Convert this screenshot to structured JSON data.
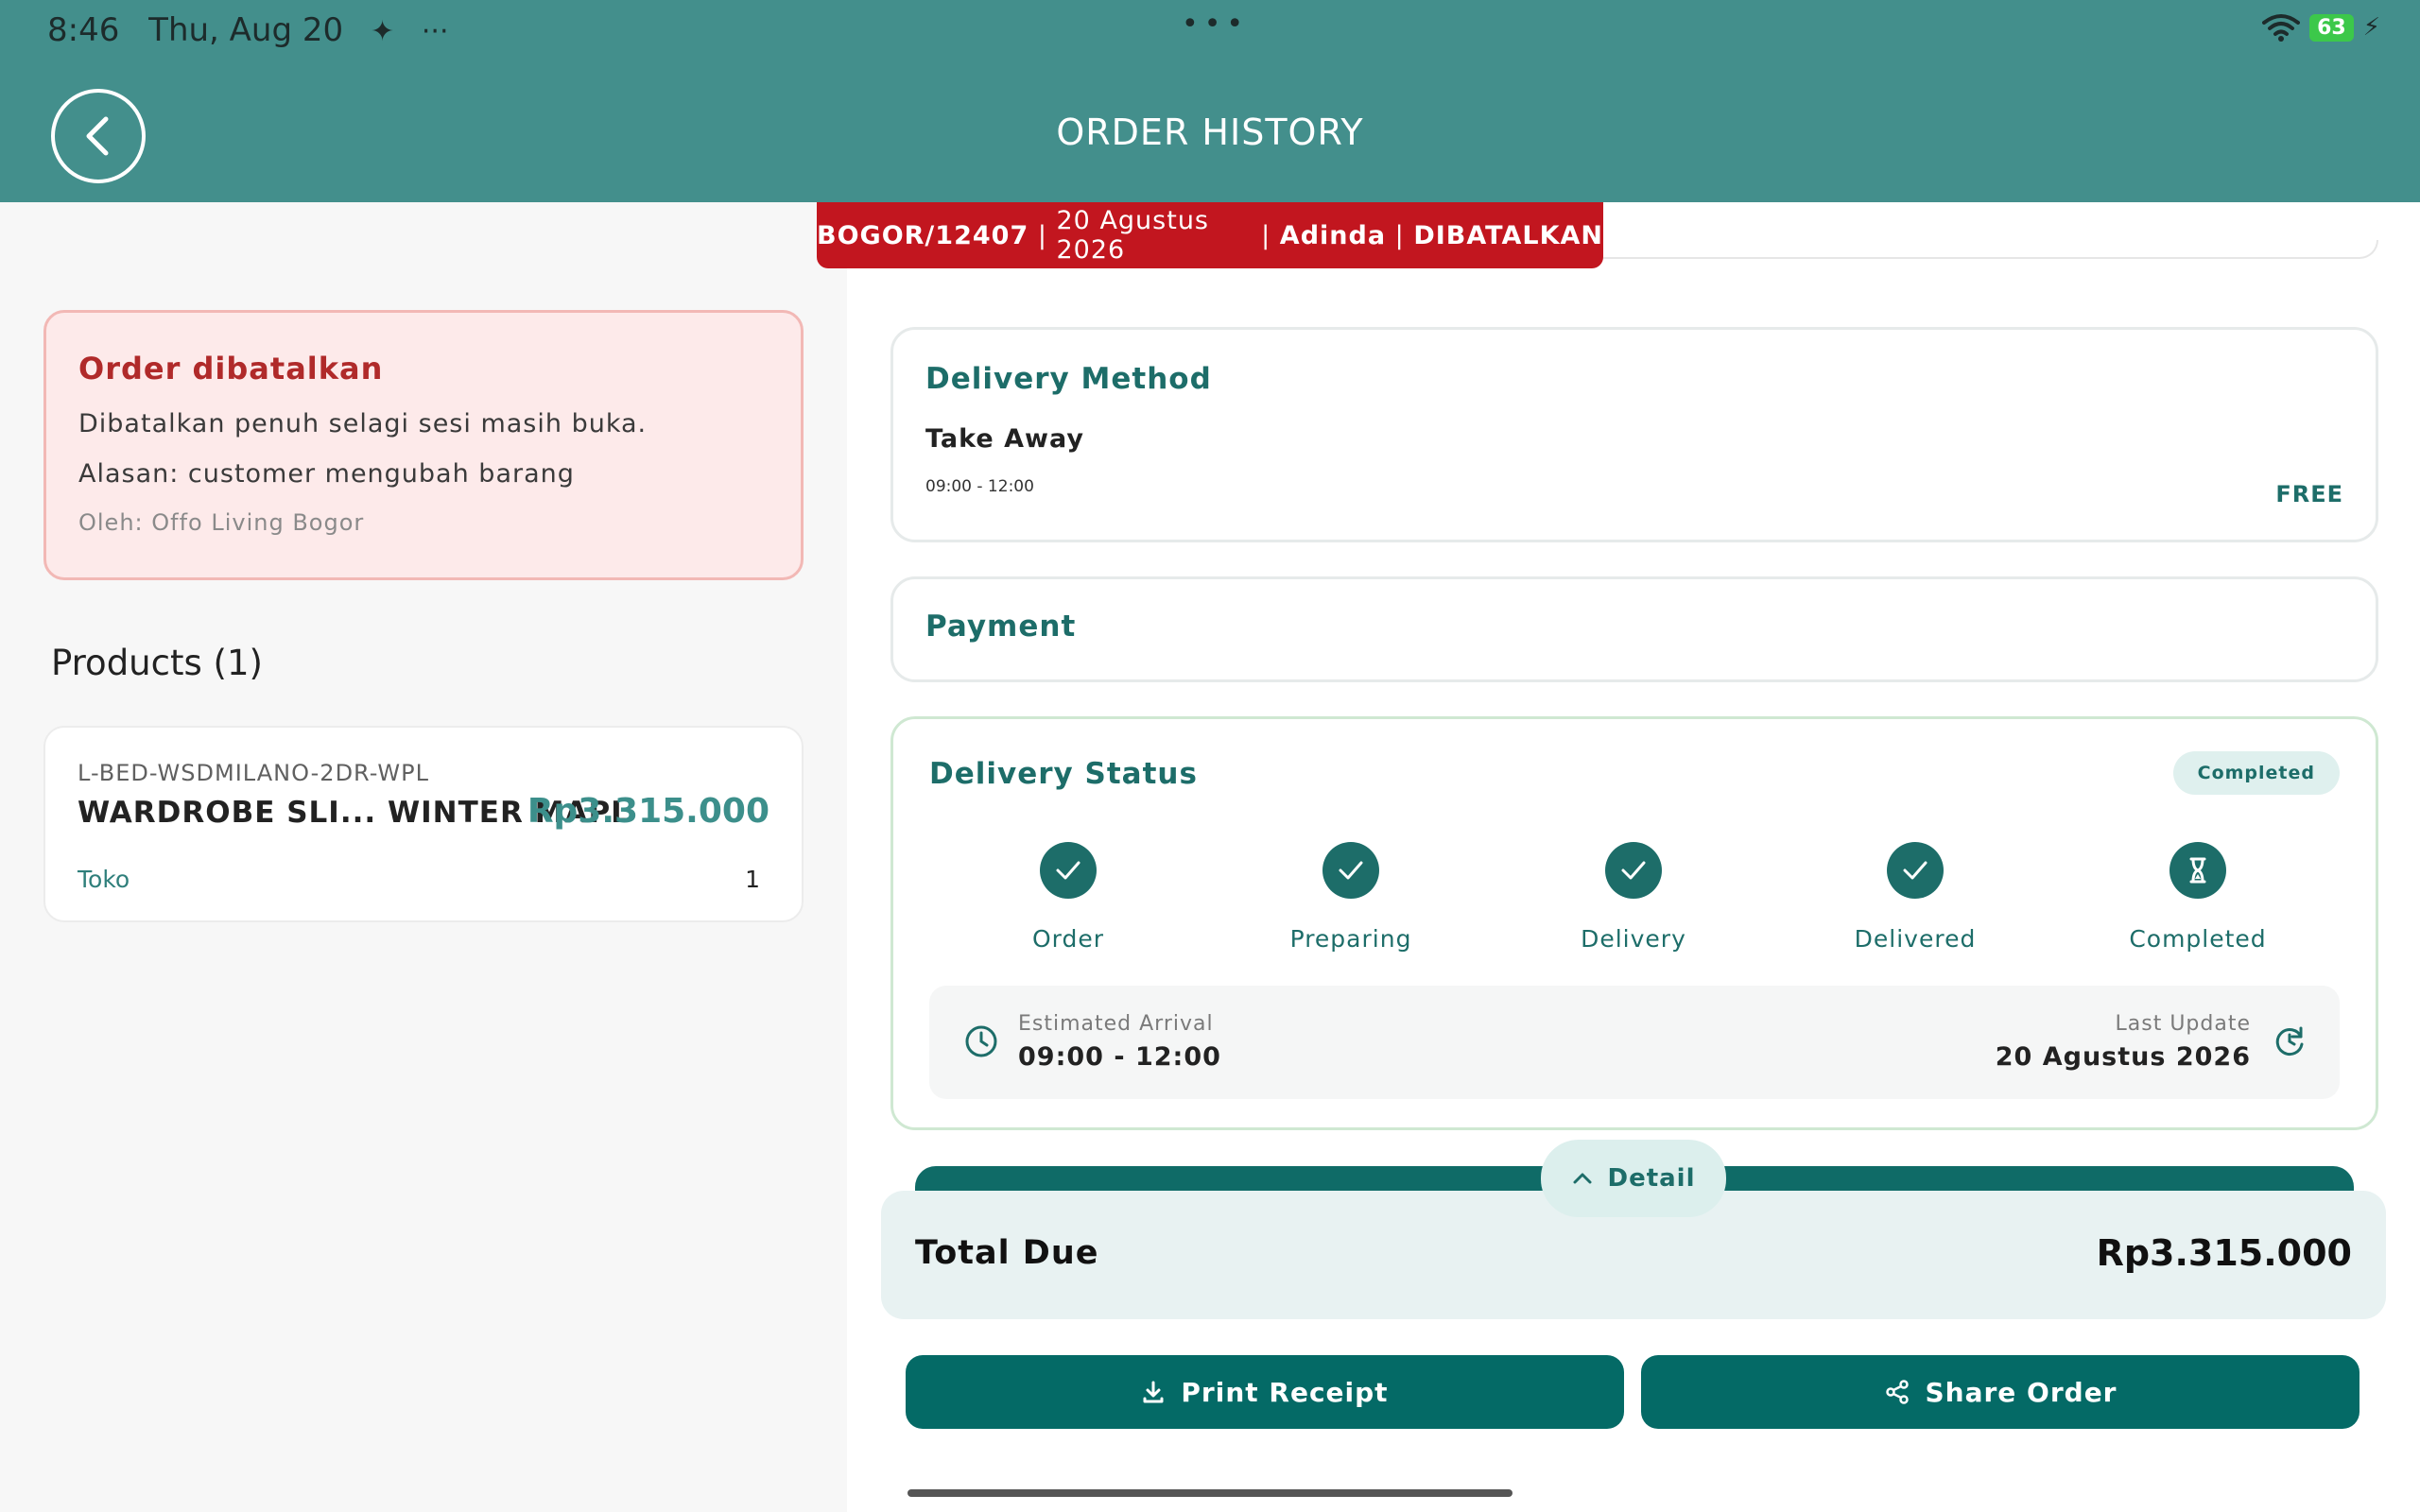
{
  "status_bar": {
    "time": "8:46",
    "date": "Thu, Aug 20",
    "sparkle": "✦",
    "more": "···",
    "center_dots": "•••",
    "battery": "63"
  },
  "header": {
    "title": "ORDER HISTORY",
    "back_icon": "chevron-left-icon"
  },
  "order_strip": {
    "code": "BOGOR/12407",
    "sep1": " | ",
    "date": "20 Agustus 2026",
    "sep2": " | ",
    "customer": "Adinda",
    "sep3": " | ",
    "status": "DIBATALKAN"
  },
  "cancel_notice": {
    "title": "Order dibatalkan",
    "line1": "Dibatalkan penuh selagi sesi masih buka.",
    "line2": "Alasan: customer mengubah barang",
    "by": "Oleh: Offo Living Bogor"
  },
  "products": {
    "title": "Products (1)",
    "items": [
      {
        "sku": "L-BED-WSDMILANO-2DR-WPL",
        "name": "WARDROBE SLI... WINTER MAPL",
        "price": "Rp3.315.000",
        "store": "Toko",
        "qty": "1"
      }
    ]
  },
  "delivery_method": {
    "title": "Delivery Method",
    "method": "Take Away",
    "time": "09:00 - 12:00",
    "fee": "FREE"
  },
  "payment": {
    "title": "Payment"
  },
  "delivery_status": {
    "title": "Delivery Status",
    "badge": "Completed",
    "steps": [
      {
        "label": "Order",
        "icon": "check-icon"
      },
      {
        "label": "Preparing",
        "icon": "check-icon"
      },
      {
        "label": "Delivery",
        "icon": "check-icon"
      },
      {
        "label": "Delivered",
        "icon": "check-icon"
      },
      {
        "label": "Completed",
        "icon": "hourglass-icon"
      }
    ],
    "eta_label": "Estimated Arrival",
    "eta_value": "09:00 - 12:00",
    "last_update_label": "Last Update",
    "last_update_value": "20 Agustus 2026"
  },
  "summary": {
    "detail_label": "Detail",
    "total_label": "Total Due",
    "total_value": "Rp3.315.000"
  },
  "actions": {
    "print_label": "Print Receipt",
    "share_label": "Share Order"
  },
  "colors": {
    "header": "#438f8c",
    "primary": "#046a66",
    "danger": "#c2161f"
  }
}
